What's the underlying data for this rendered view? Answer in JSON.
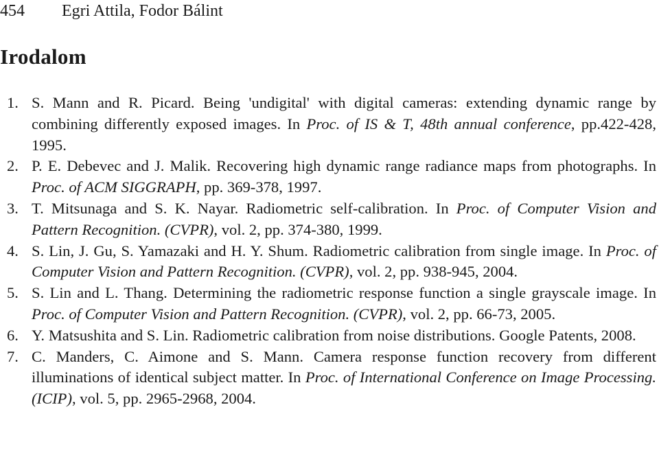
{
  "header": {
    "page_number": "454",
    "authors": "Egri Attila, Fodor Bálint"
  },
  "section": {
    "title": "Irodalom"
  },
  "references": [
    {
      "number": "1.",
      "parts": [
        {
          "text": "S. Mann and R. Picard. Being 'undigital' with digital cameras: extending dynamic range by combining differently exposed images. In ",
          "italic": false
        },
        {
          "text": "Proc. of IS & T, 48th annual conference",
          "italic": true
        },
        {
          "text": ", pp.422-428, 1995.",
          "italic": false
        }
      ]
    },
    {
      "number": "2.",
      "parts": [
        {
          "text": "P. E. Debevec and J. Malik. Recovering high dynamic range radiance maps from photographs. In ",
          "italic": false
        },
        {
          "text": "Proc. of ACM SIGGRAPH",
          "italic": true
        },
        {
          "text": ", pp. 369-378, 1997.",
          "italic": false
        }
      ]
    },
    {
      "number": "3.",
      "parts": [
        {
          "text": "T. Mitsunaga and S. K. Nayar. Radiometric self-calibration. In ",
          "italic": false
        },
        {
          "text": "Proc. of Computer Vision and Pattern Recognition. (CVPR)",
          "italic": true
        },
        {
          "text": ", vol. 2, pp. 374-380, 1999.",
          "italic": false
        }
      ]
    },
    {
      "number": "4.",
      "parts": [
        {
          "text": "S. Lin, J. Gu, S. Yamazaki and H. Y. Shum. Radiometric calibration from single image. In ",
          "italic": false
        },
        {
          "text": "Proc. of Computer Vision and Pattern Recognition. (CVPR)",
          "italic": true
        },
        {
          "text": ", vol. 2, pp. 938-945, 2004.",
          "italic": false
        }
      ]
    },
    {
      "number": "5.",
      "parts": [
        {
          "text": "S. Lin and L. Thang. Determining the radiometric response function a single grayscale image. In ",
          "italic": false
        },
        {
          "text": "Proc. of Computer Vision and Pattern Recognition. (CVPR)",
          "italic": true
        },
        {
          "text": ", vol. 2, pp. 66-73, 2005.",
          "italic": false
        }
      ]
    },
    {
      "number": "6.",
      "parts": [
        {
          "text": "Y. Matsushita and S. Lin. Radiometric calibration from noise distributions. Google Patents, 2008.",
          "italic": false
        },
        {
          "text": "",
          "italic": true
        },
        {
          "text": "",
          "italic": false
        }
      ]
    },
    {
      "number": "7.",
      "parts": [
        {
          "text": "C. Manders, C. Aimone and S. Mann. Camera response function recovery from different illuminations of identical subject matter. In ",
          "italic": false
        },
        {
          "text": "Proc. of International Conference on Image Processing. (ICIP)",
          "italic": true
        },
        {
          "text": ", vol. 5, pp. 2965-2968, 2004.",
          "italic": false
        }
      ]
    }
  ]
}
